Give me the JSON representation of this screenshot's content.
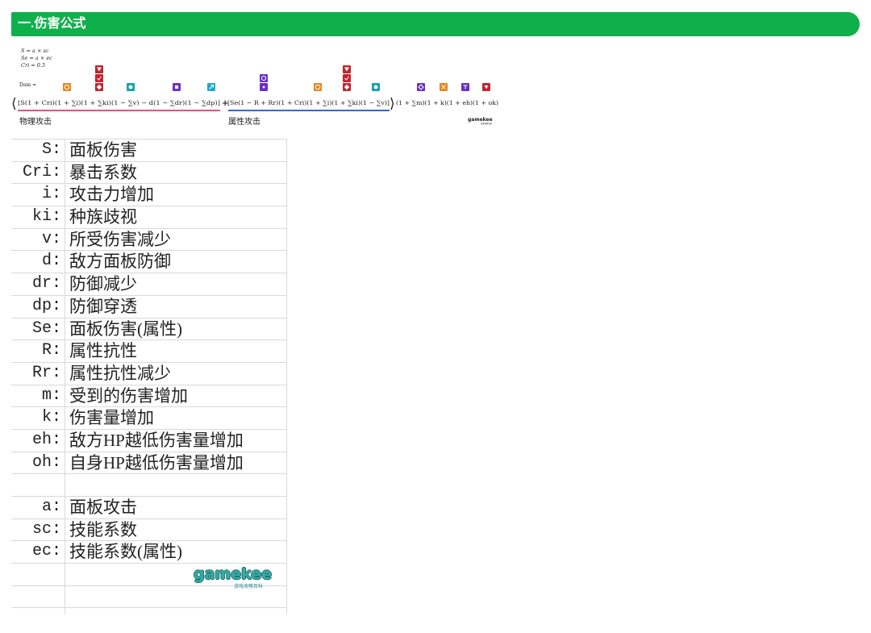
{
  "section": {
    "title": "一.伤害公式",
    "color": "#0fb04b"
  },
  "formula": {
    "definitions": [
      "S = a × sc",
      "Se = a × ec",
      "Cri = 0.5"
    ],
    "dam_label": "Dam =",
    "open_bracket": "⟨",
    "physical_part": "[S(1 + Cri)(1 + ∑i)(1 + ∑ki)(1 − ∑v) − d(1 − ∑dr)(1 − ∑dp)]",
    "plus": "+",
    "attribute_part": "[Se(1 − R + Rr)(1 + Cri)(1 + ∑i)(1 + ∑ki)(1 − ∑v)]",
    "close_bracket": "⟩",
    "multiplier_part": "(1 + ∑m)(1 + k)(1 + eh)(1 + ok)",
    "physical_label": "物理攻击",
    "attribute_label": "属性攻击",
    "colors": {
      "physical": "#e8507e",
      "attribute": "#3a63d4",
      "orange": "#e6861c",
      "red": "#c3242f",
      "teal": "#16a2b4",
      "purple": "#6a31c2",
      "cyan": "#1fa9cf",
      "logo": "#37aaa6"
    },
    "icon_names": [
      "attack-up-icon",
      "race-damage-icon",
      "damage-reduction-icon",
      "defense-down-icon",
      "defense-pierce-icon",
      "resist-down-icon",
      "damage-taken-up-icon",
      "damage-up-icon",
      "enemy-low-hp-damage-icon",
      "self-low-hp-damage-icon"
    ]
  },
  "glossary": {
    "variables": [
      {
        "symbol": "S:",
        "meaning": "面板伤害"
      },
      {
        "symbol": "Cri:",
        "meaning": "暴击系数"
      },
      {
        "symbol": "i:",
        "meaning": "攻击力增加"
      },
      {
        "symbol": "ki:",
        "meaning": "种族歧视"
      },
      {
        "symbol": "v:",
        "meaning": "所受伤害减少"
      },
      {
        "symbol": "d:",
        "meaning": "敌方面板防御"
      },
      {
        "symbol": "dr:",
        "meaning": "防御减少"
      },
      {
        "symbol": "dp:",
        "meaning": "防御穿透"
      },
      {
        "symbol": "Se:",
        "meaning": "面板伤害(属性)"
      },
      {
        "symbol": "R:",
        "meaning": "属性抗性"
      },
      {
        "symbol": "Rr:",
        "meaning": "属性抗性减少"
      },
      {
        "symbol": "m:",
        "meaning": "受到的伤害增加"
      },
      {
        "symbol": "k:",
        "meaning": "伤害量增加"
      },
      {
        "symbol": "eh:",
        "meaning": "敌方HP越低伤害量增加"
      },
      {
        "symbol": "oh:",
        "meaning": "自身HP越低伤害量增加"
      }
    ],
    "base": [
      {
        "symbol": "a:",
        "meaning": "面板攻击"
      },
      {
        "symbol": "sc:",
        "meaning": "技能系数"
      },
      {
        "symbol": "ec:",
        "meaning": "技能系数(属性)"
      }
    ]
  },
  "logo": {
    "name": "gamekee",
    "tagline": "游戏攻略百科"
  }
}
